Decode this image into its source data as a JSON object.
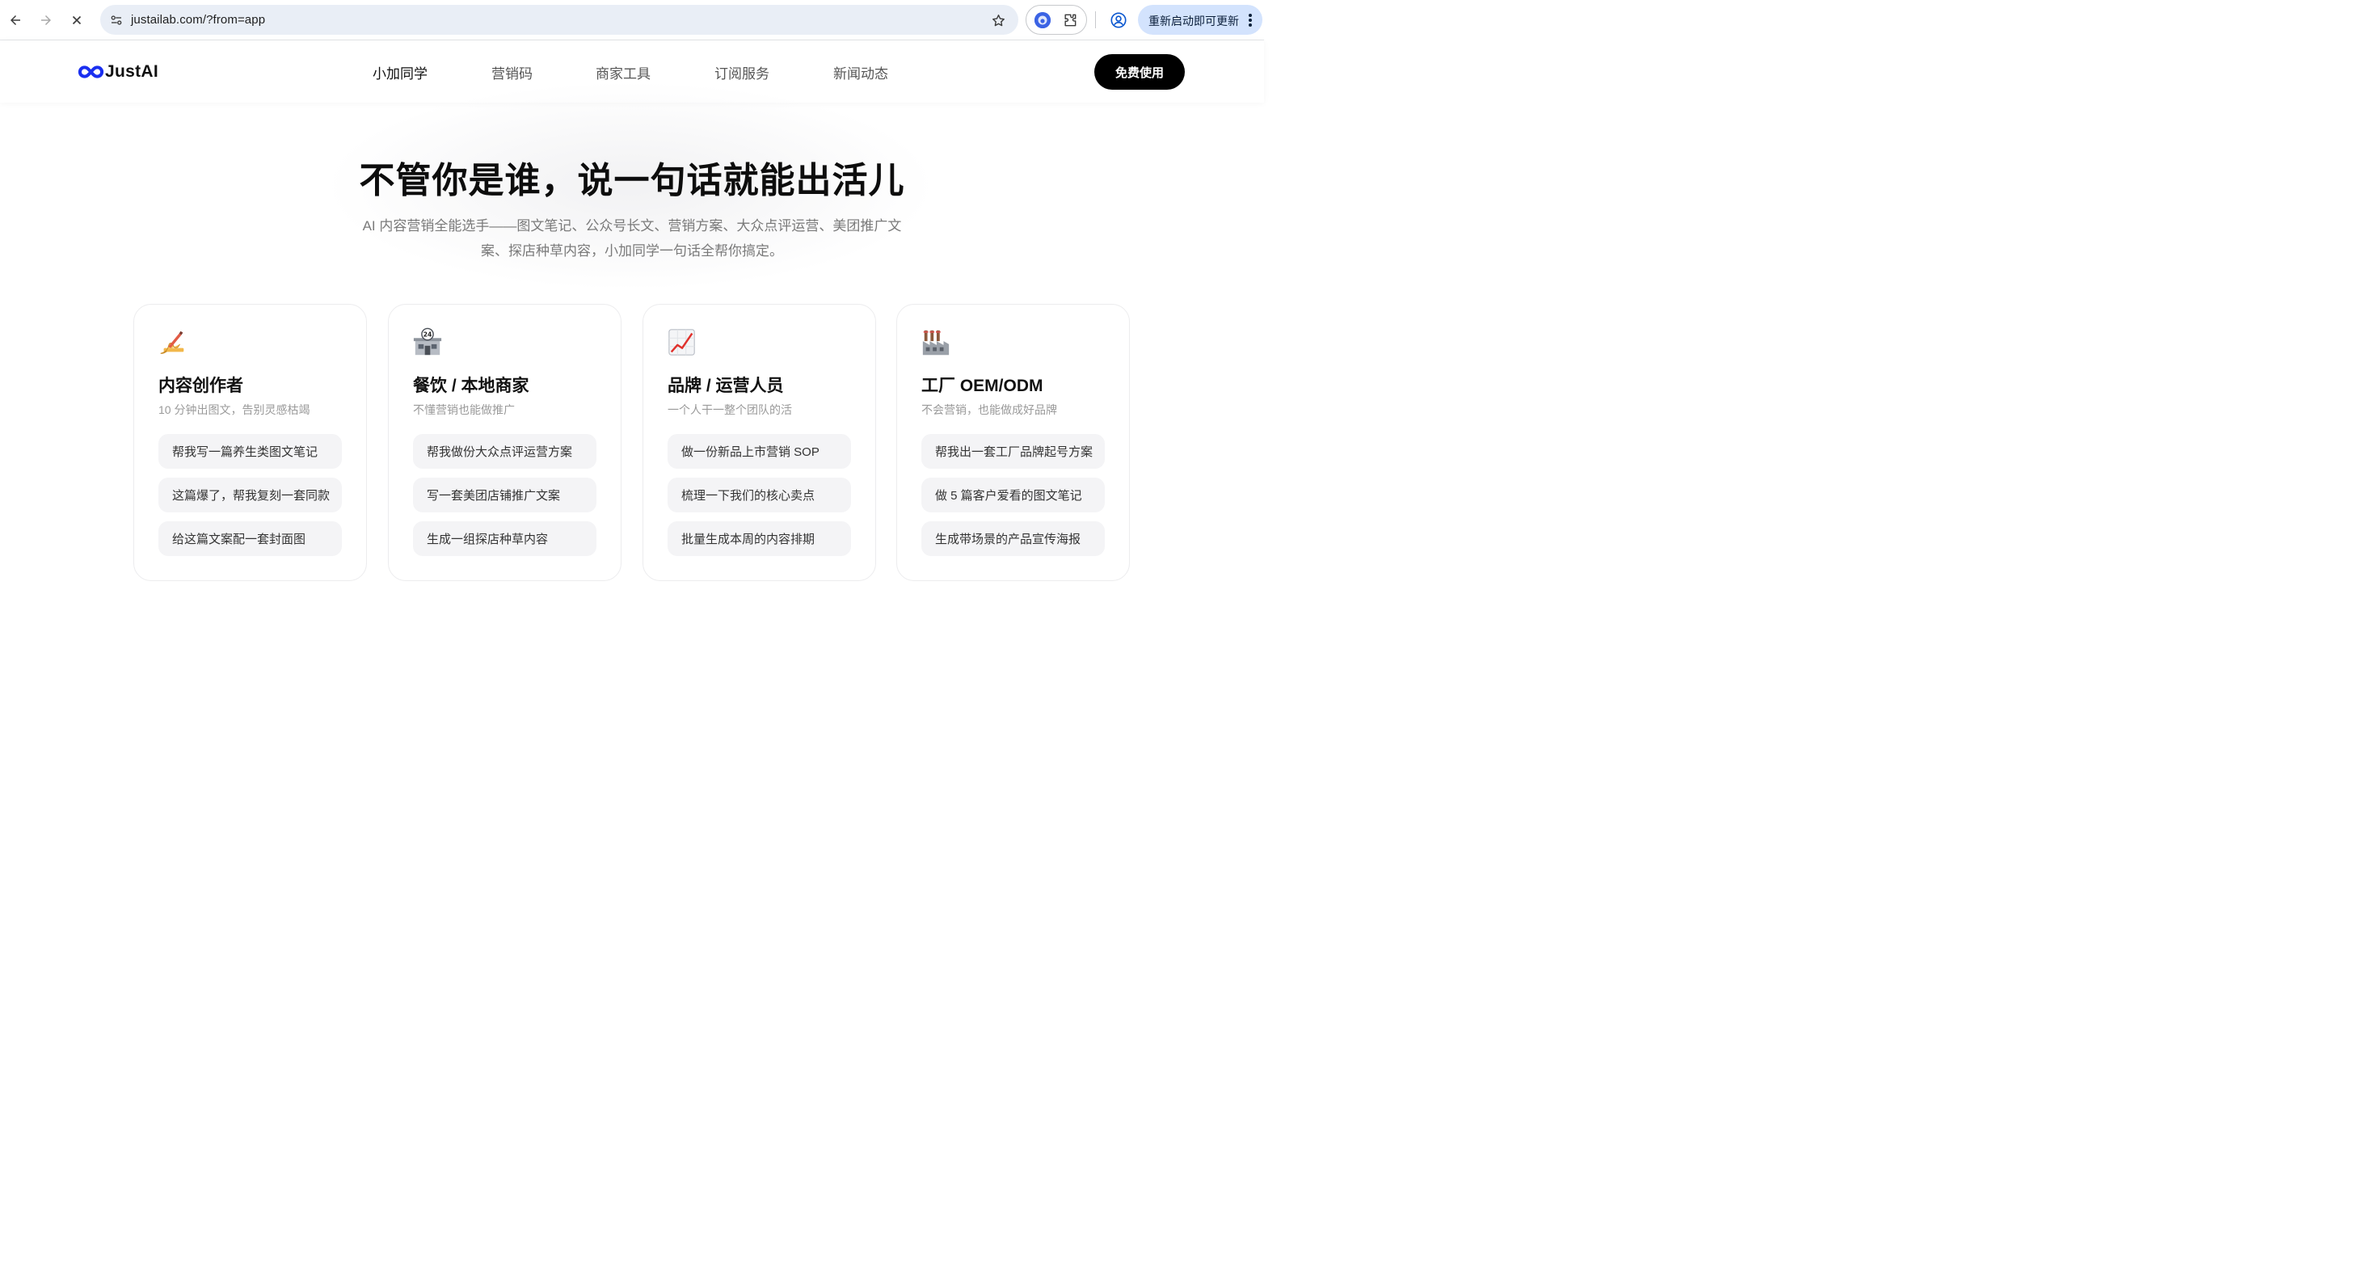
{
  "browser": {
    "url": "justailab.com/?from=app",
    "update_label": "重新启动即可更新",
    "icons": [
      "back-arrow-icon",
      "forward-arrow-icon",
      "stop-loading-icon",
      "site-info-icon",
      "bookmark-star-icon",
      "extension-icon",
      "puzzle-extensions-icon",
      "profile-icon",
      "more-vert-icon"
    ]
  },
  "header": {
    "logo_text": "JustAI",
    "nav": [
      {
        "label": "小加同学",
        "active": true
      },
      {
        "label": "营销码",
        "active": false
      },
      {
        "label": "商家工具",
        "active": false
      },
      {
        "label": "订阅服务",
        "active": false
      },
      {
        "label": "新闻动态",
        "active": false
      }
    ],
    "cta_label": "免费使用"
  },
  "hero": {
    "title": "不管你是谁，说一句话就能出活儿",
    "subtitle_line1": "AI 内容营销全能选手——图文笔记、公众号长文、营销方案、大众点评运营、美团推广文",
    "subtitle_line2": "案、探店种草内容，小加同学一句话全帮你搞定。"
  },
  "cards": [
    {
      "icon": "writing-hand-icon",
      "title": "内容创作者",
      "desc": "10 分钟出图文，告别灵感枯竭",
      "prompts": [
        "帮我写一篇养生类图文笔记",
        "这篇爆了，帮我复刻一套同款",
        "给这篇文案配一套封面图"
      ]
    },
    {
      "icon": "convenience-store-icon",
      "title": "餐饮 / 本地商家",
      "desc": "不懂营销也能做推广",
      "prompts": [
        "帮我做份大众点评运营方案",
        "写一套美团店铺推广文案",
        "生成一组探店种草内容"
      ]
    },
    {
      "icon": "chart-increasing-icon",
      "title": "品牌 / 运营人员",
      "desc": "一个人干一整个团队的活",
      "prompts": [
        "做一份新品上市营销 SOP",
        "梳理一下我们的核心卖点",
        "批量生成本周的内容排期"
      ]
    },
    {
      "icon": "factory-icon",
      "title": "工厂 OEM/ODM",
      "desc": "不会营销，也能做成好品牌",
      "prompts": [
        "帮我出一套工厂品牌起号方案",
        "做 5 篇客户爱看的图文笔记",
        "生成带场景的产品宣传海报"
      ]
    }
  ],
  "colors": {
    "logo_blue": "#1a2ff0",
    "cta_bg": "#000000",
    "omnibox_bg": "#e9eef6",
    "update_pill_bg": "#d3e3fd",
    "prompt_bg": "#f4f4f6"
  }
}
